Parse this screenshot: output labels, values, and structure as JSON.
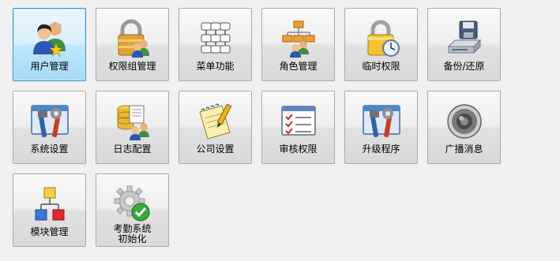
{
  "tiles": [
    {
      "label": "用户管理",
      "icon": "users-icon",
      "selected": true
    },
    {
      "label": "权限组管理",
      "icon": "lock-group-icon"
    },
    {
      "label": "菜单功能",
      "icon": "menu-tree-icon"
    },
    {
      "label": "角色管理",
      "icon": "role-tree-icon"
    },
    {
      "label": "临时权限",
      "icon": "lock-clock-icon"
    },
    {
      "label": "备份/还原",
      "icon": "backup-drive-icon"
    },
    {
      "label": "系统设置",
      "icon": "system-tools-icon"
    },
    {
      "label": "日志配置",
      "icon": "log-database-icon"
    },
    {
      "label": "公司设置",
      "icon": "notepad-pencil-icon"
    },
    {
      "label": "审核权限",
      "icon": "checklist-icon"
    },
    {
      "label": "升级程序",
      "icon": "upgrade-tools-icon"
    },
    {
      "label": "广播消息",
      "icon": "speaker-icon"
    },
    {
      "label": "模块管理",
      "icon": "module-hierarchy-icon"
    },
    {
      "label_line1": "考勤系统",
      "label_line2": "初始化",
      "icon": "gear-check-icon"
    }
  ]
}
